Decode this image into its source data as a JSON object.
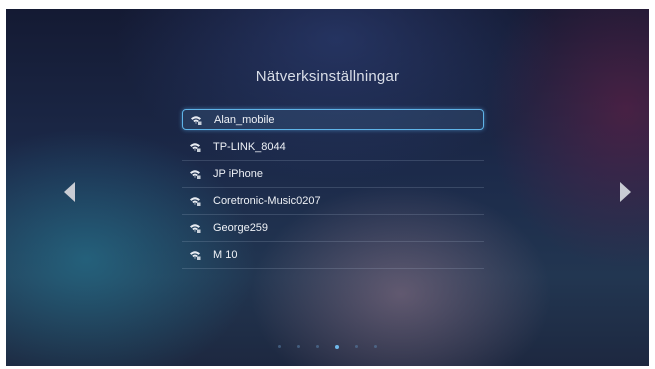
{
  "page": {
    "title": "Nätverksinställningar"
  },
  "networks": [
    {
      "name": "Alan_mobile",
      "selected": true
    },
    {
      "name": "TP-LINK_8044",
      "selected": false
    },
    {
      "name": "JP iPhone",
      "selected": false
    },
    {
      "name": "Coretronic-Music0207",
      "selected": false
    },
    {
      "name": "George259",
      "selected": false
    },
    {
      "name": "M 10",
      "selected": false
    }
  ],
  "icons": {
    "network": "wifi-icon",
    "prev": "arrow-left-icon",
    "next": "arrow-right-icon"
  },
  "pagination": {
    "total": 6,
    "current": 4
  },
  "colors": {
    "accent": "#5fb4e8",
    "text": "#eef1f6"
  }
}
